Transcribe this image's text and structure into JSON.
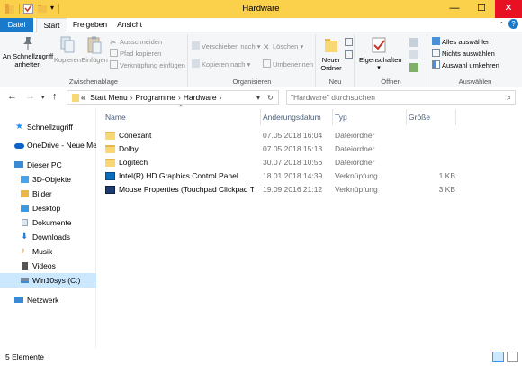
{
  "window": {
    "title": "Hardware",
    "controls": {
      "minimize": "—",
      "maximize": "☐",
      "close": "✕"
    },
    "title_bar_color": "#fbd04a"
  },
  "tabs": [
    {
      "label": "Datei"
    },
    {
      "label": "Start"
    },
    {
      "label": "Freigeben"
    },
    {
      "label": "Ansicht"
    }
  ],
  "ribbon": {
    "clipboard": {
      "group_label": "Zwischenablage",
      "pin": "An Schnellzugriff anheften",
      "copy": "Kopieren",
      "paste": "Einfügen",
      "cut": "Ausschneiden",
      "copy_path": "Pfad kopieren",
      "paste_shortcut": "Verknüpfung einfügen"
    },
    "organize": {
      "group_label": "Organisieren",
      "move_to": "Verschieben nach",
      "copy_to": "Kopieren nach",
      "delete": "Löschen",
      "rename": "Umbenennen"
    },
    "new": {
      "group_label": "Neu",
      "new_folder": "Neuer Ordner"
    },
    "open": {
      "group_label": "Öffnen",
      "properties": "Eigenschaften"
    },
    "select": {
      "group_label": "Auswählen",
      "select_all": "Alles auswählen",
      "select_none": "Nichts auswählen",
      "invert": "Auswahl umkehren"
    }
  },
  "address": {
    "breadcrumb": [
      "«",
      "Start Menu",
      "Programme",
      "Hardware"
    ],
    "search_placeholder": "\"Hardware\" durchsuchen"
  },
  "nav_pane": [
    {
      "label": "Schnellzugriff",
      "icon": "star-icon",
      "color": "#1e90ff"
    },
    {
      "label": "OneDrive - Neue Me",
      "icon": "cloud-icon",
      "color": "#0a64c8"
    },
    {
      "label": "Dieser PC",
      "icon": "computer-icon",
      "color": "#3a8ad6"
    },
    {
      "label": "3D-Objekte",
      "icon": "cube-icon",
      "color": "#4aa3e8"
    },
    {
      "label": "Bilder",
      "icon": "pictures-icon",
      "color": "#e8b74a"
    },
    {
      "label": "Desktop",
      "icon": "desktop-icon",
      "color": "#3a9ae0"
    },
    {
      "label": "Dokumente",
      "icon": "documents-icon",
      "color": "#9aa6b3"
    },
    {
      "label": "Downloads",
      "icon": "download-icon",
      "color": "#2a7fd4"
    },
    {
      "label": "Musik",
      "icon": "music-icon",
      "color": "#e08a2a"
    },
    {
      "label": "Videos",
      "icon": "video-icon",
      "color": "#555555"
    },
    {
      "label": "Win10sys (C:)",
      "icon": "drive-icon",
      "color": "#7a8a99"
    },
    {
      "label": "Netzwerk",
      "icon": "network-icon",
      "color": "#3a8ad6"
    }
  ],
  "columns": {
    "name": "Name",
    "date": "Änderungsdatum",
    "type": "Typ",
    "size": "Größe"
  },
  "files": [
    {
      "name": "Conexant",
      "date": "07.05.2018 16:04",
      "type": "Dateiordner",
      "size": "",
      "icon": "folder-icon"
    },
    {
      "name": "Dolby",
      "date": "07.05.2018 15:13",
      "type": "Dateiordner",
      "size": "",
      "icon": "folder-icon"
    },
    {
      "name": "Logitech",
      "date": "30.07.2018 10:56",
      "type": "Dateiordner",
      "size": "",
      "icon": "folder-icon"
    },
    {
      "name": "Intel(R) HD Graphics Control Panel",
      "date": "18.01.2018 14:39",
      "type": "Verknüpfung",
      "size": "1 KB",
      "icon": "intel-shortcut-icon"
    },
    {
      "name": "Mouse Properties (Touchpad Clickpad Tr...",
      "date": "19.09.2016 21:12",
      "type": "Verknüpfung",
      "size": "3 KB",
      "icon": "mouse-shortcut-icon"
    }
  ],
  "status": {
    "item_count": "5 Elemente"
  }
}
